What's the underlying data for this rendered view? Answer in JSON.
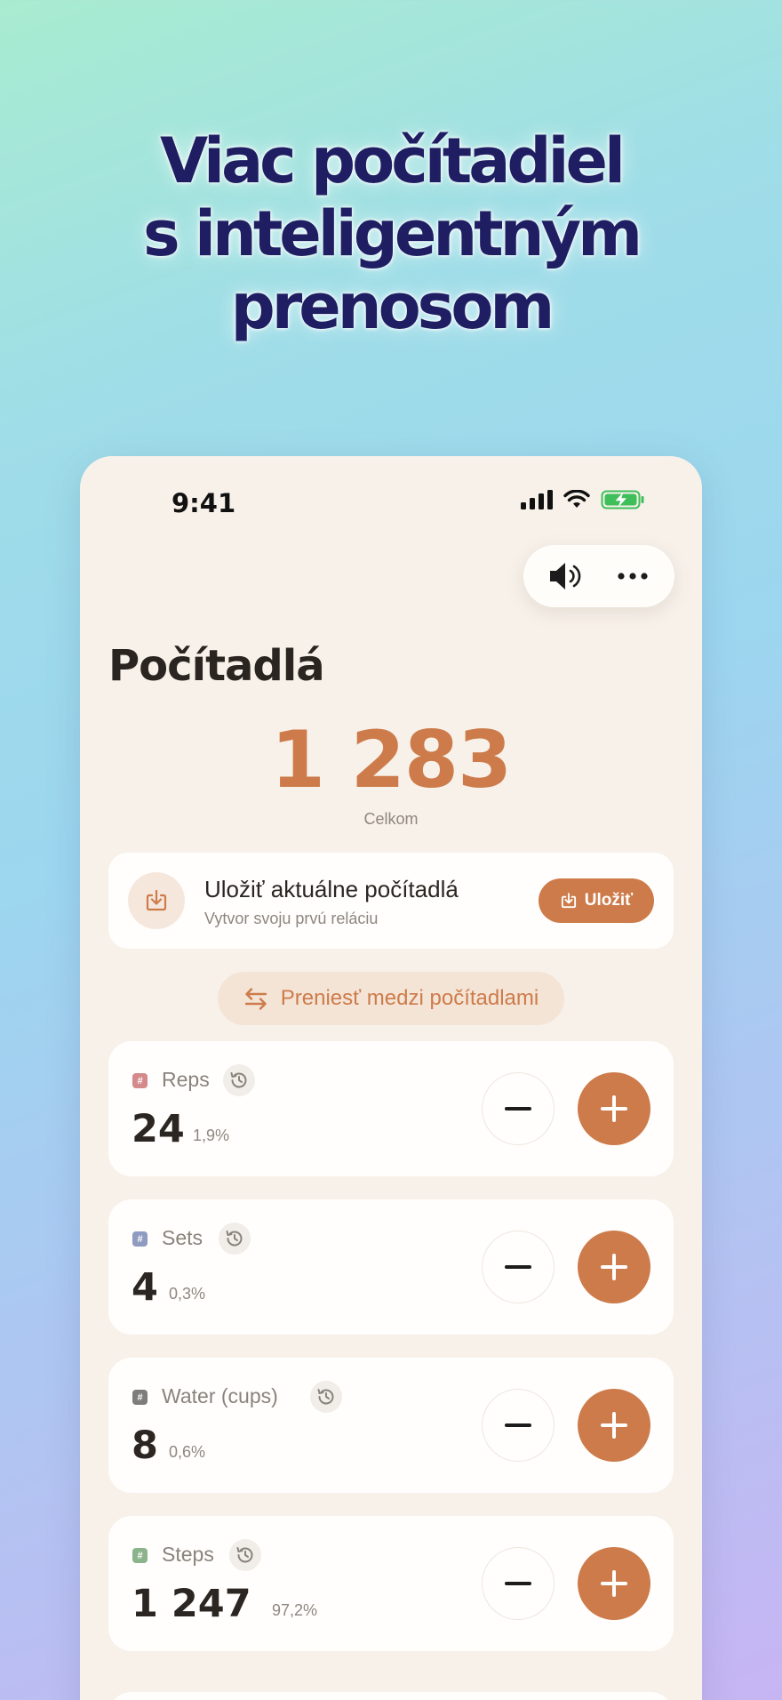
{
  "headline": {
    "line1": "Viac počítadiel",
    "line2": "s inteligentným",
    "line3": "prenosom"
  },
  "status": {
    "time": "9:41"
  },
  "toolbar": {
    "sound_icon": "speaker-icon",
    "more_icon": "more-dots-icon"
  },
  "page": {
    "title": "Počítadlá",
    "total": "1 283",
    "total_label": "Celkom"
  },
  "save_card": {
    "title": "Uložiť aktuálne počítadlá",
    "subtitle": "Vytvor svoju prvú reláciu",
    "button_label": "Uložiť"
  },
  "transfer": {
    "label": "Preniesť medzi počítadlami"
  },
  "counters": [
    {
      "name": "Reps",
      "value": "24",
      "percent": "1,9%",
      "color": "#d48a8a"
    },
    {
      "name": "Sets",
      "value": "4",
      "percent": "0,3%",
      "color": "#8f9bc0"
    },
    {
      "name": "Water (cups)",
      "value": "8",
      "percent": "0,6%",
      "color": "#7d7d7a"
    },
    {
      "name": "Steps",
      "value": "1 247",
      "percent": "97,2%",
      "color": "#8cb48c"
    }
  ],
  "colors": {
    "accent": "#cd7b4a",
    "background": "#f7f1ea",
    "card": "#fffefc"
  }
}
